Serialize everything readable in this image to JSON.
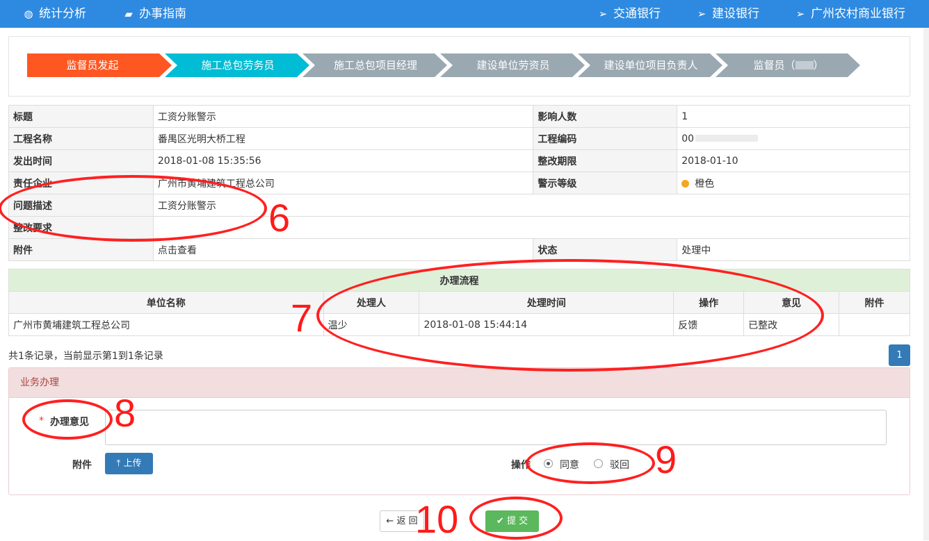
{
  "nav": {
    "left": [
      {
        "label": "统计分析",
        "icon": "globe-icon"
      },
      {
        "label": "办事指南",
        "icon": "book-icon"
      }
    ],
    "right": [
      {
        "label": "交通银行",
        "icon": "paper-plane-icon"
      },
      {
        "label": "建设银行",
        "icon": "paper-plane-icon"
      },
      {
        "label": "广州农村商业银行",
        "icon": "paper-plane-icon"
      }
    ]
  },
  "steps": [
    "监督员发起",
    "施工总包劳务员",
    "施工总包项目经理",
    "建设单位劳资员",
    "建设单位项目负责人",
    "监督员（"
  ],
  "steps_tail": "）",
  "info": {
    "title_label": "标题",
    "title": "工资分账警示",
    "affected_label": "影响人数",
    "affected": "1",
    "project_label": "工程名称",
    "project": "番禺区光明大桥工程",
    "code_label": "工程编码",
    "code": "00",
    "issued_label": "发出时间",
    "issued": "2018-01-08 15:35:56",
    "deadline_label": "整改期限",
    "deadline": "2018-01-10",
    "company_label": "责任企业",
    "company": "广州市黄埔建筑工程总公司",
    "level_label": "警示等级",
    "level": "橙色",
    "desc_label": "问题描述",
    "desc": "工资分账警示",
    "require_label": "整改要求",
    "require": "",
    "attach_label": "附件",
    "attach": "点击查看",
    "status_label": "状态",
    "status": "处理中"
  },
  "flow": {
    "title": "办理流程",
    "headers": [
      "单位名称",
      "处理人",
      "处理时间",
      "操作",
      "意见",
      "附件"
    ],
    "rows": [
      [
        "广州市黄埔建筑工程总公司",
        "温少",
        "2018-01-08 15:44:14",
        "反馈",
        "已整改",
        ""
      ]
    ]
  },
  "pagination": {
    "summary": "共1条记录，当前显示第1到1条记录",
    "page": "1"
  },
  "business": {
    "title": "业务办理",
    "required_mark": "*",
    "opinion_label": "办理意见",
    "attach_label": "附件",
    "upload_label": "上传",
    "op_label": "操作",
    "agree": "同意",
    "reject": "驳回"
  },
  "buttons": {
    "back": "返 回",
    "submit": "提 交"
  },
  "annotations": [
    "6",
    "7",
    "8",
    "9",
    "10"
  ],
  "colors": {
    "topbar": "#2e8ae0",
    "step_active": "#ff5722",
    "step_current": "#00bcd4",
    "step_pending": "#9aa8b1",
    "annotation": "#ff2020"
  }
}
